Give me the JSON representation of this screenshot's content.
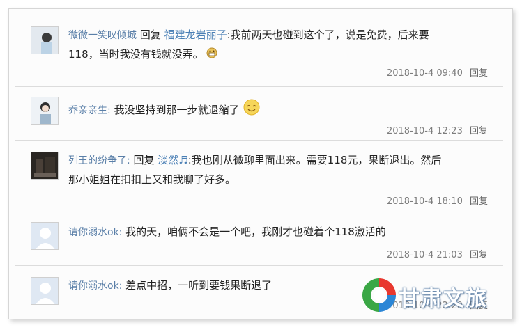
{
  "reply_label": "回复",
  "comments": [
    {
      "user": "微微一笑叹倾城",
      "reply_prefix": "回复",
      "reply_target": "福建龙岩丽子",
      "text_line1": ":我前两天也碰到这个了，说是免费，后来要",
      "text_line2": "118，当时我没有钱就没弄。",
      "emoji": "grimace-emoji",
      "time": "2018-10-4 09:40"
    },
    {
      "user": "乔亲亲生:",
      "text_line1": "我没坚持到那一步就退缩了",
      "emoji": "smile-emoji",
      "time": "2018-10-4 12:23"
    },
    {
      "user": "列王的纷争了:",
      "reply_prefix": "回复",
      "reply_target": "淡然♬",
      "text_line1": ":我也刚从微聊里面出来。需要118元，果断退出。然后",
      "text_line2": "那小姐姐在扣扣上又和我聊了好多。",
      "time": "2018-10-4 18:10"
    },
    {
      "user": "请你溺水ok:",
      "text_line1": "我的天，咱俩不会是一个吧，我刚才也碰着个118激活的",
      "time": "2018-10-4 21:03"
    },
    {
      "user": "请你溺水ok:",
      "text_line1": "差点中招，一听到要钱果断退了",
      "time": "2018-10-4 22:20"
    }
  ],
  "watermark": {
    "text": "甘肃文旅",
    "colors": {
      "red": "#e8382f",
      "green": "#3aa745",
      "blue": "#2b86d6"
    }
  }
}
